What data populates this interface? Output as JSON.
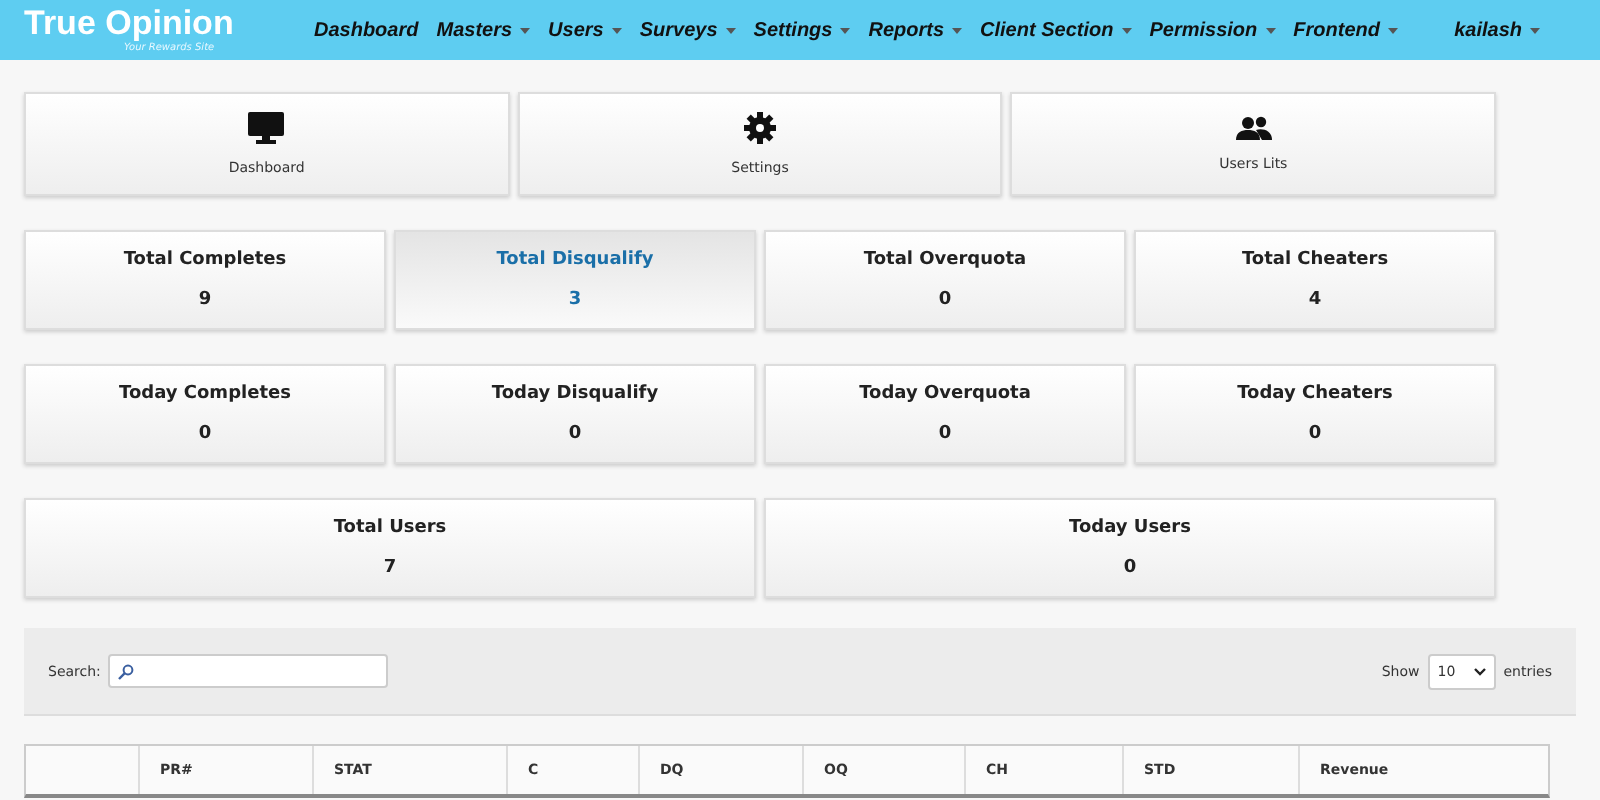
{
  "brand": {
    "name": "True Opinion",
    "tagline": "Your Rewards Site"
  },
  "nav": [
    {
      "label": "Dashboard",
      "dropdown": false
    },
    {
      "label": "Masters",
      "dropdown": true
    },
    {
      "label": "Users",
      "dropdown": true
    },
    {
      "label": "Surveys",
      "dropdown": true
    },
    {
      "label": "Settings",
      "dropdown": true
    },
    {
      "label": "Reports",
      "dropdown": true
    },
    {
      "label": "Client Section",
      "dropdown": true
    },
    {
      "label": "Permission",
      "dropdown": true
    },
    {
      "label": "Frontend",
      "dropdown": true
    }
  ],
  "user": {
    "name": "kailash"
  },
  "shortcuts": [
    {
      "label": "Dashboard",
      "kind": "monitor"
    },
    {
      "label": "Settings",
      "kind": "gear"
    },
    {
      "label": "Users Lits",
      "kind": "users"
    }
  ],
  "stat_rows": [
    [
      {
        "label": "Total Completes",
        "value": "9",
        "selected": false
      },
      {
        "label": "Total Disqualify",
        "value": "3",
        "selected": true
      },
      {
        "label": "Total Overquota",
        "value": "0",
        "selected": false
      },
      {
        "label": "Total Cheaters",
        "value": "4",
        "selected": false
      }
    ],
    [
      {
        "label": "Today Completes",
        "value": "0",
        "selected": false
      },
      {
        "label": "Today Disqualify",
        "value": "0",
        "selected": false
      },
      {
        "label": "Today Overquota",
        "value": "0",
        "selected": false
      },
      {
        "label": "Today Cheaters",
        "value": "0",
        "selected": false
      }
    ],
    [
      {
        "label": "Total Users",
        "value": "7",
        "selected": false
      },
      {
        "label": "Today Users",
        "value": "0",
        "selected": false
      }
    ]
  ],
  "table_tools": {
    "search_label": "Search:",
    "show_label": "Show",
    "page_size": "10",
    "entries_label": "entries"
  },
  "table": {
    "columns": [
      "",
      "PR#",
      "STAT",
      "C",
      "DQ",
      "OQ",
      "CH",
      "STD",
      "Revenue"
    ]
  }
}
